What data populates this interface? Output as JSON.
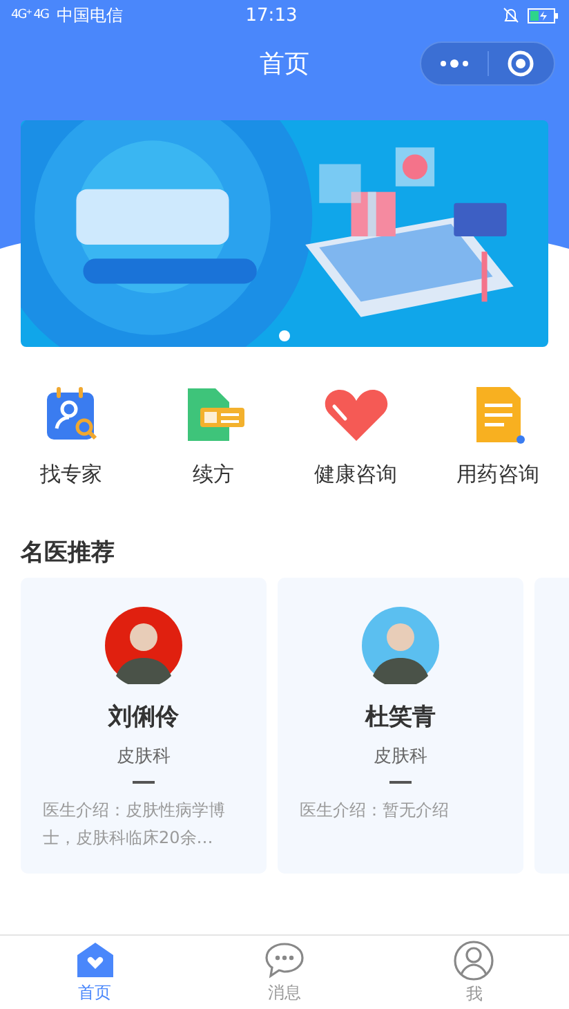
{
  "status_bar": {
    "signal": "4G⁺ 4G",
    "carrier": "中国电信",
    "time": "17:13"
  },
  "nav": {
    "title": "首页"
  },
  "banner": {
    "pages": [
      {
        "selected": true
      }
    ]
  },
  "shortcuts": [
    {
      "kind": "expert",
      "label": "找专家"
    },
    {
      "kind": "renew",
      "label": "续方"
    },
    {
      "kind": "health",
      "label": "健康咨询"
    },
    {
      "kind": "drug",
      "label": "用药咨询"
    }
  ],
  "section": {
    "title": "名医推荐"
  },
  "doctors": [
    {
      "name": "刘俐伶",
      "dept": "皮肤科",
      "intro": "医生介绍：皮肤性病学博士，皮肤科临床20余…"
    },
    {
      "name": "杜笑青",
      "dept": "皮肤科",
      "intro": "医生介绍：暂无介绍"
    }
  ],
  "tabs": [
    {
      "kind": "home",
      "label": "首页",
      "selected": true
    },
    {
      "kind": "message",
      "label": "消息",
      "selected": false
    },
    {
      "kind": "me",
      "label": "我",
      "selected": false
    }
  ]
}
